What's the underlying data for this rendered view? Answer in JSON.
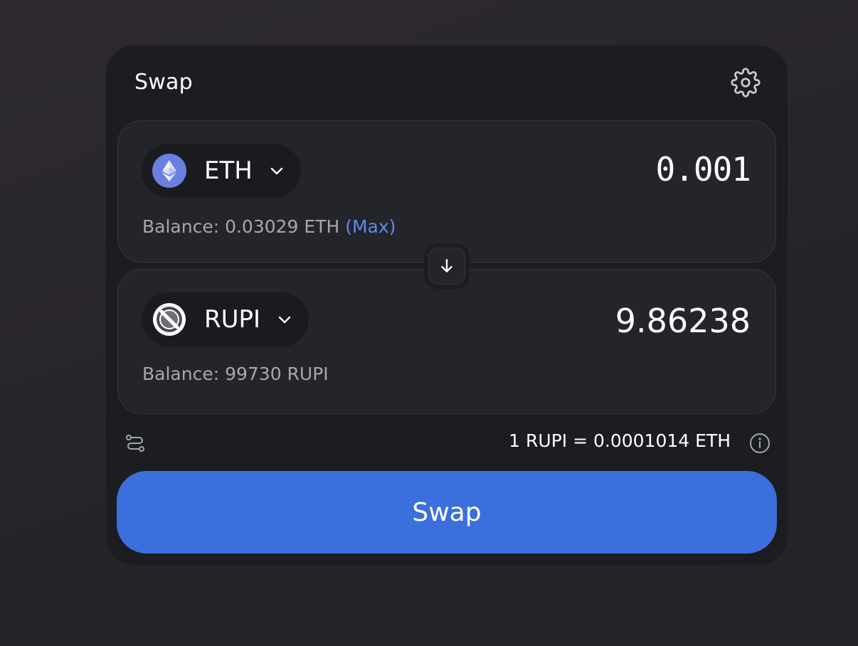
{
  "card": {
    "title": "Swap",
    "settings_icon": "gear-icon"
  },
  "from": {
    "token_symbol": "ETH",
    "token_icon": "eth-logo-icon",
    "amount": "0.001",
    "balance_label": "Balance: 0.03029 ETH",
    "max_label": "(Max)"
  },
  "switch": {
    "icon": "arrow-down-icon"
  },
  "to": {
    "token_symbol": "RUPI",
    "token_icon": "no-symbol-icon",
    "amount": "9.86238",
    "balance_label": "Balance: 99730 RUPI"
  },
  "footer": {
    "route_icon": "route-icon",
    "rate": "1 RUPI = 0.0001014 ETH",
    "info_icon": "info-icon"
  },
  "swap_button": {
    "label": "Swap"
  },
  "colors": {
    "background": "#28252b",
    "card": "#1c1d21",
    "panel": "#23252a",
    "accent": "#3b6fdc",
    "max_link": "#5b8de8",
    "eth_logo": "#6b7fe0"
  }
}
